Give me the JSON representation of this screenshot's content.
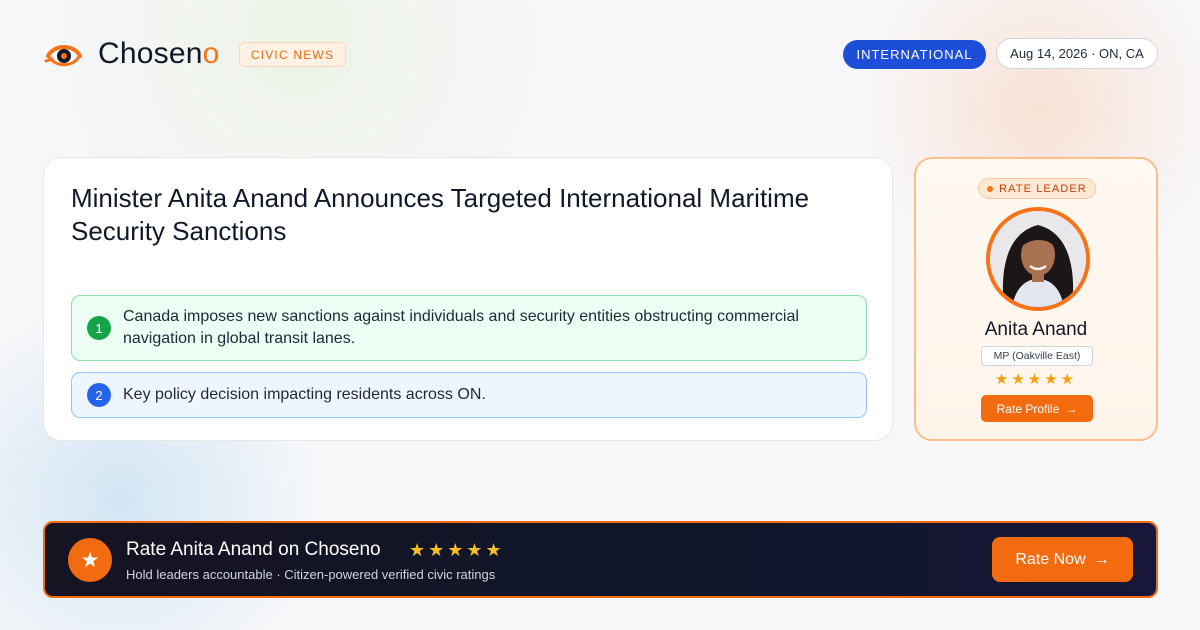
{
  "header": {
    "brand_name": "Chosen",
    "brand_o": "o",
    "logo_icon": "eye-logo-icon",
    "section_badge": "CIVIC NEWS",
    "category": "INTERNATIONAL",
    "dateline": "Aug 14, 2026 · ON, CA"
  },
  "article": {
    "title": "Minister Anita Anand Announces Targeted International Maritime Security Sanctions",
    "points": [
      {
        "number": "1",
        "text": "Canada imposes new sanctions against individuals and security entities obstructing commercial navigation in global transit lanes."
      },
      {
        "number": "2",
        "text": "Key policy decision impacting residents across ON."
      }
    ]
  },
  "rate_card": {
    "badge": "RATE LEADER",
    "name": "Anita Anand",
    "role": "MP (Oakville East)",
    "stars": "★★★★★",
    "button_label": "Rate Profile",
    "button_arrow": "→"
  },
  "banner": {
    "icon": "star-icon",
    "icon_glyph": "★",
    "title": "Rate Anita Anand on Choseno",
    "stars": "★★★★★",
    "subtitle": "Hold leaders accountable · Citizen-powered verified civic ratings",
    "button_label": "Rate Now",
    "button_arrow": "→"
  },
  "colors": {
    "accent": "#f26b0f",
    "blue": "#1d4ed8",
    "green": "#16a34a",
    "star": "#f59e0b"
  }
}
